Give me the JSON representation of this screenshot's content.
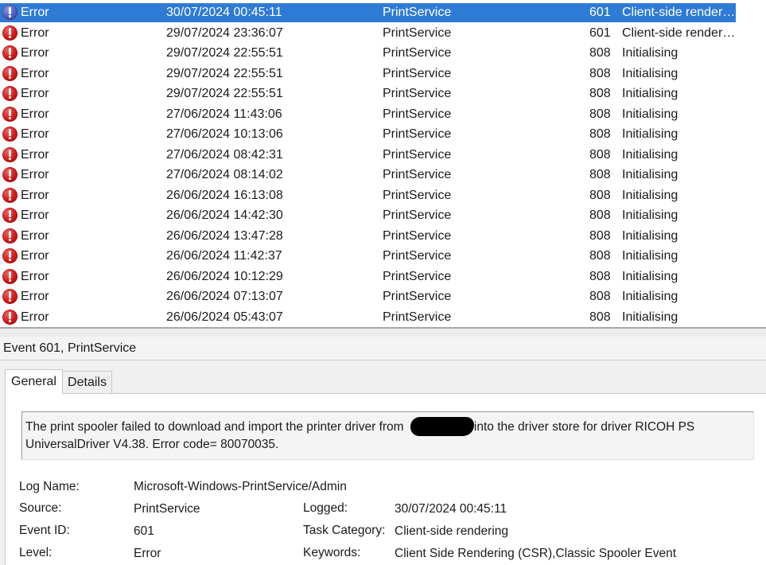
{
  "events": [
    {
      "level": "Error",
      "date": "30/07/2024 00:45:11",
      "source": "PrintService",
      "event_id": "601",
      "task": "Client-side render…",
      "selected": true
    },
    {
      "level": "Error",
      "date": "29/07/2024 23:36:07",
      "source": "PrintService",
      "event_id": "601",
      "task": "Client-side render…"
    },
    {
      "level": "Error",
      "date": "29/07/2024 22:55:51",
      "source": "PrintService",
      "event_id": "808",
      "task": "Initialising"
    },
    {
      "level": "Error",
      "date": "29/07/2024 22:55:51",
      "source": "PrintService",
      "event_id": "808",
      "task": "Initialising"
    },
    {
      "level": "Error",
      "date": "29/07/2024 22:55:51",
      "source": "PrintService",
      "event_id": "808",
      "task": "Initialising"
    },
    {
      "level": "Error",
      "date": "27/06/2024 11:43:06",
      "source": "PrintService",
      "event_id": "808",
      "task": "Initialising"
    },
    {
      "level": "Error",
      "date": "27/06/2024 10:13:06",
      "source": "PrintService",
      "event_id": "808",
      "task": "Initialising"
    },
    {
      "level": "Error",
      "date": "27/06/2024 08:42:31",
      "source": "PrintService",
      "event_id": "808",
      "task": "Initialising"
    },
    {
      "level": "Error",
      "date": "27/06/2024 08:14:02",
      "source": "PrintService",
      "event_id": "808",
      "task": "Initialising"
    },
    {
      "level": "Error",
      "date": "26/06/2024 16:13:08",
      "source": "PrintService",
      "event_id": "808",
      "task": "Initialising"
    },
    {
      "level": "Error",
      "date": "26/06/2024 14:42:30",
      "source": "PrintService",
      "event_id": "808",
      "task": "Initialising"
    },
    {
      "level": "Error",
      "date": "26/06/2024 13:47:28",
      "source": "PrintService",
      "event_id": "808",
      "task": "Initialising"
    },
    {
      "level": "Error",
      "date": "26/06/2024 11:42:37",
      "source": "PrintService",
      "event_id": "808",
      "task": "Initialising"
    },
    {
      "level": "Error",
      "date": "26/06/2024 10:12:29",
      "source": "PrintService",
      "event_id": "808",
      "task": "Initialising"
    },
    {
      "level": "Error",
      "date": "26/06/2024 07:13:07",
      "source": "PrintService",
      "event_id": "808",
      "task": "Initialising"
    },
    {
      "level": "Error",
      "date": "26/06/2024 05:43:07",
      "source": "PrintService",
      "event_id": "808",
      "task": "Initialising"
    }
  ],
  "detail": {
    "header": "Event 601, PrintService",
    "tabs": {
      "general": "General",
      "details": "Details"
    },
    "description_part1": "The print spooler failed to download and import the printer driver from ",
    "description_part2": "into the driver store for driver RICOH PS UniversalDriver V4.38. Error code= 80070035.",
    "props": {
      "log_name_label": "Log Name:",
      "log_name_value": "Microsoft-Windows-PrintService/Admin",
      "source_label": "Source:",
      "source_value": "PrintService",
      "logged_label": "Logged:",
      "logged_value": "30/07/2024 00:45:11",
      "event_id_label": "Event ID:",
      "event_id_value": "601",
      "task_label": "Task Category:",
      "task_value": "Client-side rendering",
      "level_label": "Level:",
      "level_value": "Error",
      "keywords_label": "Keywords:",
      "keywords_value": "Client Side Rendering (CSR),Classic Spooler Event"
    }
  },
  "colors": {
    "selection": "#2e7bd6",
    "error_icon": "#d01818",
    "pane_background": "#f0f0f0"
  },
  "icons": {
    "row_level": "error-icon"
  }
}
